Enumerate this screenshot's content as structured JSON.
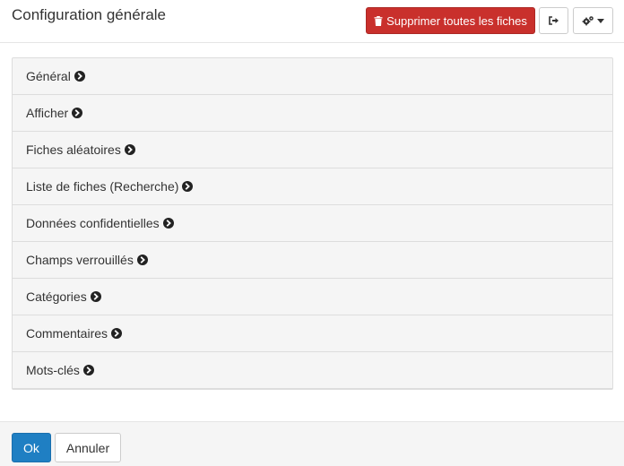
{
  "header": {
    "title": "Configuration générale",
    "delete_all_label": "Supprimer toutes les fiches"
  },
  "sections": [
    {
      "label": "Général"
    },
    {
      "label": "Afficher"
    },
    {
      "label": "Fiches aléatoires"
    },
    {
      "label": "Liste de fiches (Recherche)"
    },
    {
      "label": "Données confidentielles"
    },
    {
      "label": "Champs verrouillés"
    },
    {
      "label": "Catégories"
    },
    {
      "label": "Commentaires"
    },
    {
      "label": "Mots-clés"
    }
  ],
  "footer": {
    "ok_label": "Ok",
    "cancel_label": "Annuler"
  },
  "icons": {
    "delete": "trash-icon",
    "exit": "sign-out-icon",
    "settings": "cogs-icon",
    "caret": "caret-down-icon",
    "section": "chevron-circle-right-icon"
  },
  "colors": {
    "danger": "#c9302c",
    "primary": "#1f7fc3",
    "panel_bg": "#f5f5f5"
  }
}
